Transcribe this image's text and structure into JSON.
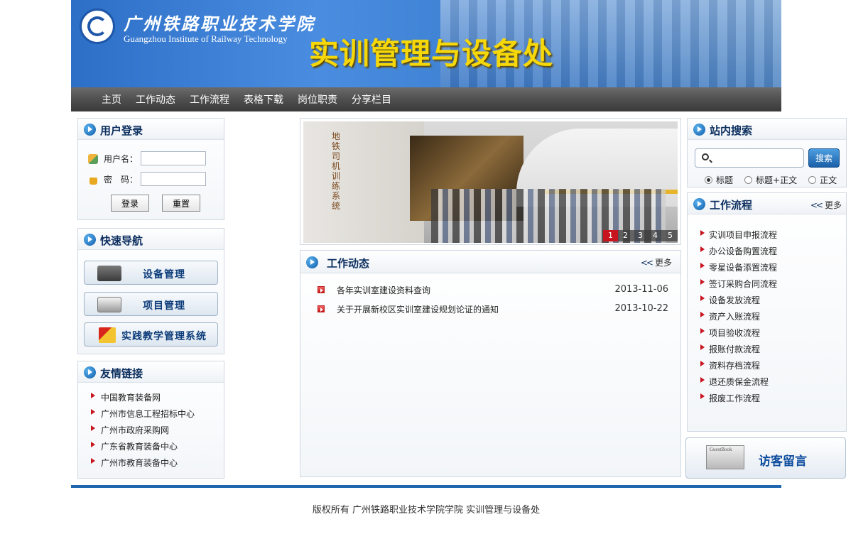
{
  "header": {
    "school_cn": "广州铁路职业技术学院",
    "school_en": "Guangzhou Institute of Railway Technology",
    "department": "实训管理与设备处"
  },
  "nav": [
    "主页",
    "工作动态",
    "工作流程",
    "表格下载",
    "岗位职责",
    "分享栏目"
  ],
  "login": {
    "title": "用户登录",
    "username_label": "用户名：",
    "password_label": "密　码：",
    "username_value": "",
    "password_value": "",
    "login_button": "登录",
    "reset_button": "重置"
  },
  "quicknav": {
    "title": "快速导航",
    "items": [
      "设备管理",
      "项目管理",
      "实践教学管理系统"
    ]
  },
  "links": {
    "title": "友情链接",
    "items": [
      "中国教育装备网",
      "广州市信息工程招标中心",
      "广州市政府采购网",
      "广东省教育装备中心",
      "广州市教育装备中心"
    ]
  },
  "slider": {
    "wall_text": "地铁司机训练系统",
    "pages": [
      "1",
      "2",
      "3",
      "4",
      "5"
    ],
    "active_page": "1"
  },
  "news": {
    "title": "工作动态",
    "more": "更多",
    "items": [
      {
        "title": "各年实训室建设资料查询",
        "date": "2013-11-06"
      },
      {
        "title": "关于开展新校区实训室建设规划论证的通知",
        "date": "2013-10-22"
      }
    ]
  },
  "search": {
    "title": "站内搜索",
    "query": "",
    "button": "搜索",
    "options": [
      "标题",
      "标题+正文",
      "正文"
    ],
    "selected": "标题"
  },
  "flow": {
    "title": "工作流程",
    "more": "更多",
    "items": [
      "实训项目申报流程",
      "办公设备购置流程",
      "零星设备添置流程",
      "签订采购合同流程",
      "设备发放流程",
      "资产入账流程",
      "项目验收流程",
      "报账付款流程",
      "资料存档流程",
      "退还质保金流程",
      "报废工作流程"
    ]
  },
  "guestbook": {
    "label": "访客留言",
    "book_text": "GuestBook"
  },
  "footer": {
    "text": "版权所有 广州铁路职业技术学院学院 实训管理与设备处"
  },
  "colors": {
    "brand_blue": "#1f66b0",
    "title_navy": "#0c2f5f",
    "dept_yellow": "#f5d70a",
    "accent_red": "#c8141e"
  }
}
